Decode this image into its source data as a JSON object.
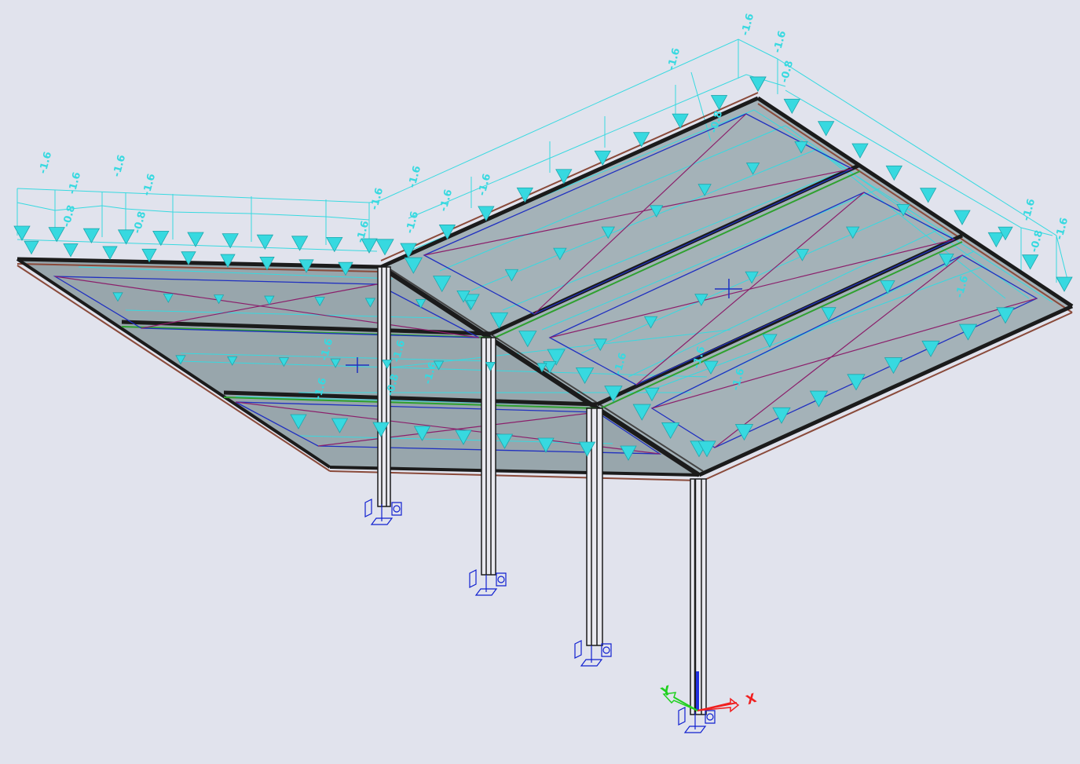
{
  "viewport": {
    "background": "#e1e3ed"
  },
  "colors": {
    "load": "#37d9e0",
    "panel": "#7f9196",
    "beam": "#1b1b1b",
    "edge_beam": "#8a4a3a",
    "purlin": "#2fa12f",
    "bracing": "#8b1f6b",
    "inner_frame": "#2030c0",
    "support": "#1020d0",
    "axis_x": "#f02020",
    "axis_y": "#20d020",
    "axis_z": "#2030e0"
  },
  "icons": {
    "support": "fixed-support-icon",
    "axis_triad": "global-axis-triad-icon",
    "local_axis": "local-axis-icon"
  },
  "loads": {
    "left_roof_labels": [
      "-1.6",
      "-1.6",
      "-1.6",
      "-1.6",
      "-0.8",
      "-0.8"
    ],
    "right_roof_labels": [
      "-1.6",
      "-1.6",
      "-1.6",
      "-1.6",
      "-1.6",
      "-0.8",
      "-0.8",
      "-1.6",
      "-1.6",
      "-1.6",
      "-0.8"
    ],
    "lower_labels": [
      "-1.6",
      "-1.6",
      "-1.6",
      "-0.8",
      "-1.6",
      "-1.6"
    ],
    "ridge_labels": [
      "-1.6",
      "-1.6",
      "-1.6"
    ],
    "central_labels": [
      "-1.6",
      "-1.6",
      "-1.6"
    ]
  },
  "axes": {
    "x": "X",
    "y": "Y"
  }
}
